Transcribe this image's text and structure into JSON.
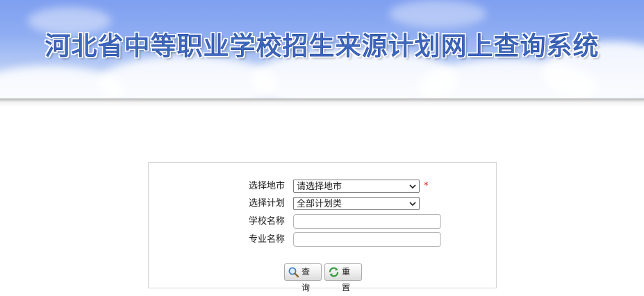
{
  "header": {
    "title": "河北省中等职业学校招生来源计划网上查询系统"
  },
  "form": {
    "city": {
      "label": "选择地市",
      "value": "请选择地市",
      "required_mark": "*"
    },
    "plan": {
      "label": "选择计划",
      "value": "全部计划类"
    },
    "school": {
      "label": "学校名称",
      "value": ""
    },
    "major": {
      "label": "专业名称",
      "value": ""
    },
    "buttons": {
      "search": {
        "label": "查询",
        "icon": "magnifier-icon"
      },
      "reset": {
        "label": "重置",
        "icon": "refresh-icon"
      }
    }
  },
  "colors": {
    "sky_top": "#7f9ff0",
    "title_fill": "#3f6ac2",
    "required": "#dd2222",
    "panel_border": "#d6d6d6"
  }
}
